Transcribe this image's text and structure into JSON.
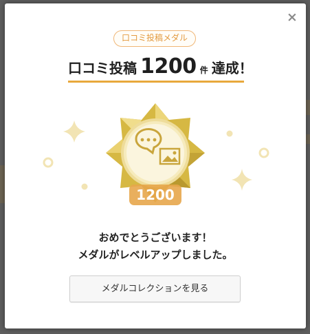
{
  "modal": {
    "close_symbol": "×",
    "badge_label": "口コミ投稿メダル",
    "headline": {
      "prefix": "口コミ投稿",
      "number": "1200",
      "unit": "件",
      "suffix": "達成！"
    },
    "medal": {
      "count_label": "1200",
      "icon": "chat-bubble-photo-icon"
    },
    "message_line1": "おめでとうございます！",
    "message_line2": "メダルがレベルアップしました。",
    "collection_button_label": "メダルコレクションを見る"
  },
  "colors": {
    "accent_orange": "#e8a83b",
    "medal_gold": "#d9bd4c",
    "medal_label": "#e7a64b",
    "sparkle": "#f2e4b4"
  }
}
